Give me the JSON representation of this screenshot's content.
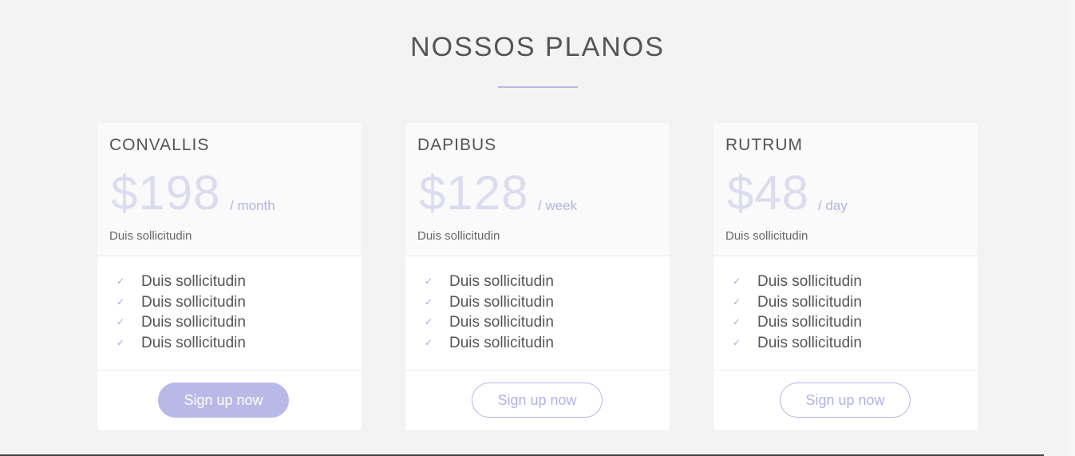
{
  "section": {
    "title": "NOSSOS PLANOS"
  },
  "plans": [
    {
      "name": "CONVALLIS",
      "price": "$198",
      "period": "/ month",
      "subtitle": "Duis sollicitudin",
      "features": [
        "Duis sollicitudin",
        "Duis sollicitudin",
        "Duis sollicitudin",
        "Duis sollicitudin"
      ],
      "button_label": "Sign up now",
      "button_style": "filled"
    },
    {
      "name": "DAPIBUS",
      "price": "$128",
      "period": "/ week",
      "subtitle": "Duis sollicitudin",
      "features": [
        "Duis sollicitudin",
        "Duis sollicitudin",
        "Duis sollicitudin",
        "Duis sollicitudin"
      ],
      "button_label": "Sign up now",
      "button_style": "outline"
    },
    {
      "name": "RUTRUM",
      "price": "$48",
      "period": "/ day",
      "subtitle": "Duis sollicitudin",
      "features": [
        "Duis sollicitudin",
        "Duis sollicitudin",
        "Duis sollicitudin",
        "Duis sollicitudin"
      ],
      "button_label": "Sign up now",
      "button_style": "outline"
    }
  ],
  "icons": {
    "feature": "check-icon"
  },
  "colors": {
    "accent": "#b8b9e6",
    "price": "#dcdcf0",
    "page_background": "#f3f3f3"
  }
}
